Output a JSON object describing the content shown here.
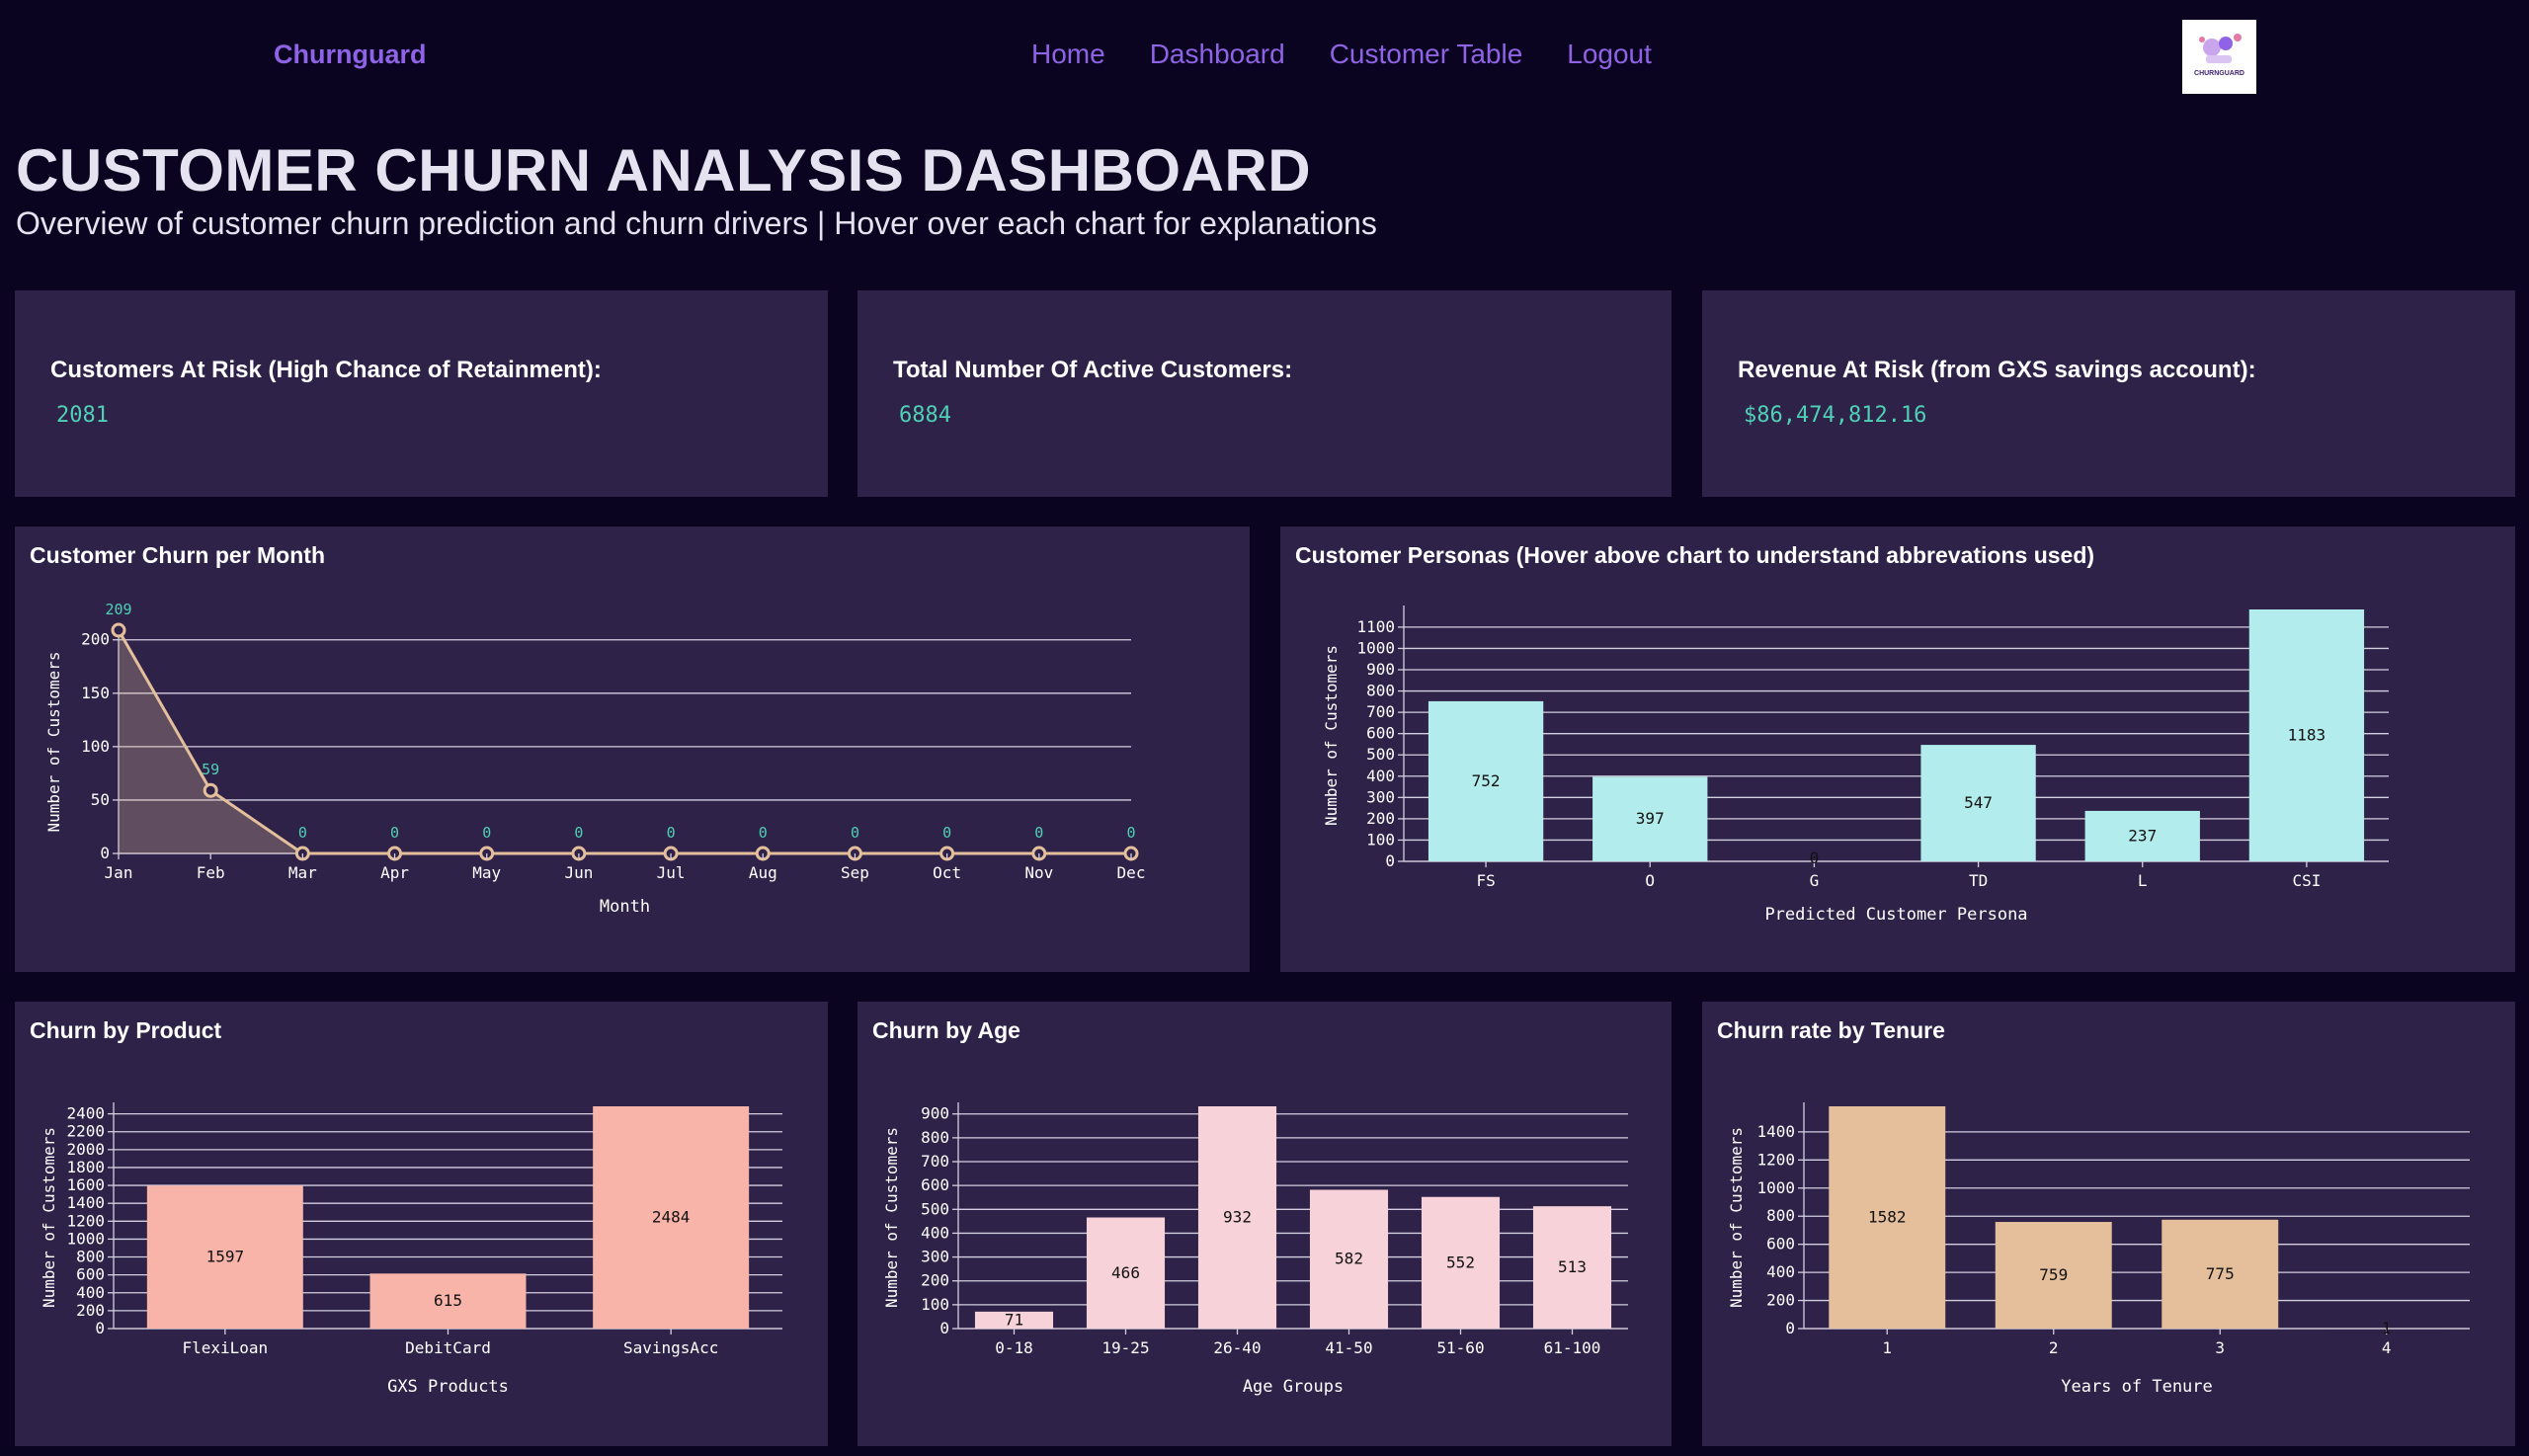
{
  "nav": {
    "brand": "Churnguard",
    "links": [
      "Home",
      "Dashboard",
      "Customer Table",
      "Logout"
    ],
    "logo_text": "CHURNGUARD"
  },
  "header": {
    "title": "CUSTOMER CHURN ANALYSIS DASHBOARD",
    "subtitle": "Overview of customer churn prediction and churn drivers | Hover over each chart for explanations"
  },
  "kpis": [
    {
      "label": "Customers At Risk (High Chance of Retainment):",
      "value": "2081"
    },
    {
      "label": "Total Number Of Active Customers:",
      "value": "6884"
    },
    {
      "label": "Revenue At Risk (from GXS savings account):",
      "value": "$86,474,812.16"
    }
  ],
  "colors": {
    "background": "#0b0420",
    "card": "#2e2248",
    "accent": "#8f63e6",
    "kpi_value": "#4fd1b5",
    "line": "#e3bf9b",
    "persona_bar": "#b3ecec",
    "product_bar": "#f9b4aa",
    "age_bar": "#f7d2d9",
    "tenure_bar": "#e5bf9c"
  },
  "chart_data": [
    {
      "id": "monthly",
      "type": "line",
      "title": "Customer Churn per Month",
      "x": [
        "Jan",
        "Feb",
        "Mar",
        "Apr",
        "May",
        "Jun",
        "Jul",
        "Aug",
        "Sep",
        "Oct",
        "Nov",
        "Dec"
      ],
      "values": [
        209,
        59,
        0,
        0,
        0,
        0,
        0,
        0,
        0,
        0,
        0,
        0
      ],
      "xlabel": "Month",
      "ylabel": "Number of Customers",
      "ylim": [
        0,
        209
      ],
      "yticks": [
        0,
        50,
        100,
        150,
        200
      ],
      "grid": true,
      "area_fill": true,
      "data_labels": true
    },
    {
      "id": "persona",
      "type": "bar",
      "title": "Customer Personas (Hover above chart to understand abbrevations used)",
      "categories": [
        "FS",
        "O",
        "G",
        "TD",
        "L",
        "CSI"
      ],
      "values": [
        752,
        397,
        0,
        547,
        237,
        1183
      ],
      "xlabel": "Predicted Customer Persona",
      "ylabel": "Number of Customers",
      "ylim": [
        0,
        1183
      ],
      "yticks": [
        0,
        100,
        200,
        300,
        400,
        500,
        600,
        700,
        800,
        900,
        1000,
        1100
      ],
      "grid": true,
      "data_labels": true
    },
    {
      "id": "product",
      "type": "bar",
      "title": "Churn by Product",
      "categories": [
        "FlexiLoan",
        "DebitCard",
        "SavingsAcc"
      ],
      "values": [
        1597,
        615,
        2484
      ],
      "xlabel": "GXS Products",
      "ylabel": "Number of Customers",
      "ylim": [
        0,
        2484
      ],
      "yticks": [
        0,
        200,
        400,
        600,
        800,
        1000,
        1200,
        1400,
        1600,
        1800,
        2000,
        2200,
        2400
      ],
      "grid": true,
      "data_labels": true
    },
    {
      "id": "age",
      "type": "bar",
      "title": "Churn by Age",
      "categories": [
        "0-18",
        "19-25",
        "26-40",
        "41-50",
        "51-60",
        "61-100"
      ],
      "values": [
        71,
        466,
        932,
        582,
        552,
        513
      ],
      "xlabel": "Age Groups",
      "ylabel": "Number of Customers",
      "ylim": [
        0,
        932
      ],
      "yticks": [
        0,
        100,
        200,
        300,
        400,
        500,
        600,
        700,
        800,
        900
      ],
      "grid": true,
      "data_labels": true
    },
    {
      "id": "tenure",
      "type": "bar",
      "title": "Churn rate by Tenure",
      "categories": [
        "1",
        "2",
        "3",
        "4"
      ],
      "values": [
        1582,
        759,
        775,
        1
      ],
      "xlabel": "Years of Tenure",
      "ylabel": "Number of Customers",
      "ylim": [
        0,
        1582
      ],
      "yticks": [
        0,
        200,
        400,
        600,
        800,
        1000,
        1200,
        1400
      ],
      "grid": true,
      "data_labels": true
    }
  ]
}
